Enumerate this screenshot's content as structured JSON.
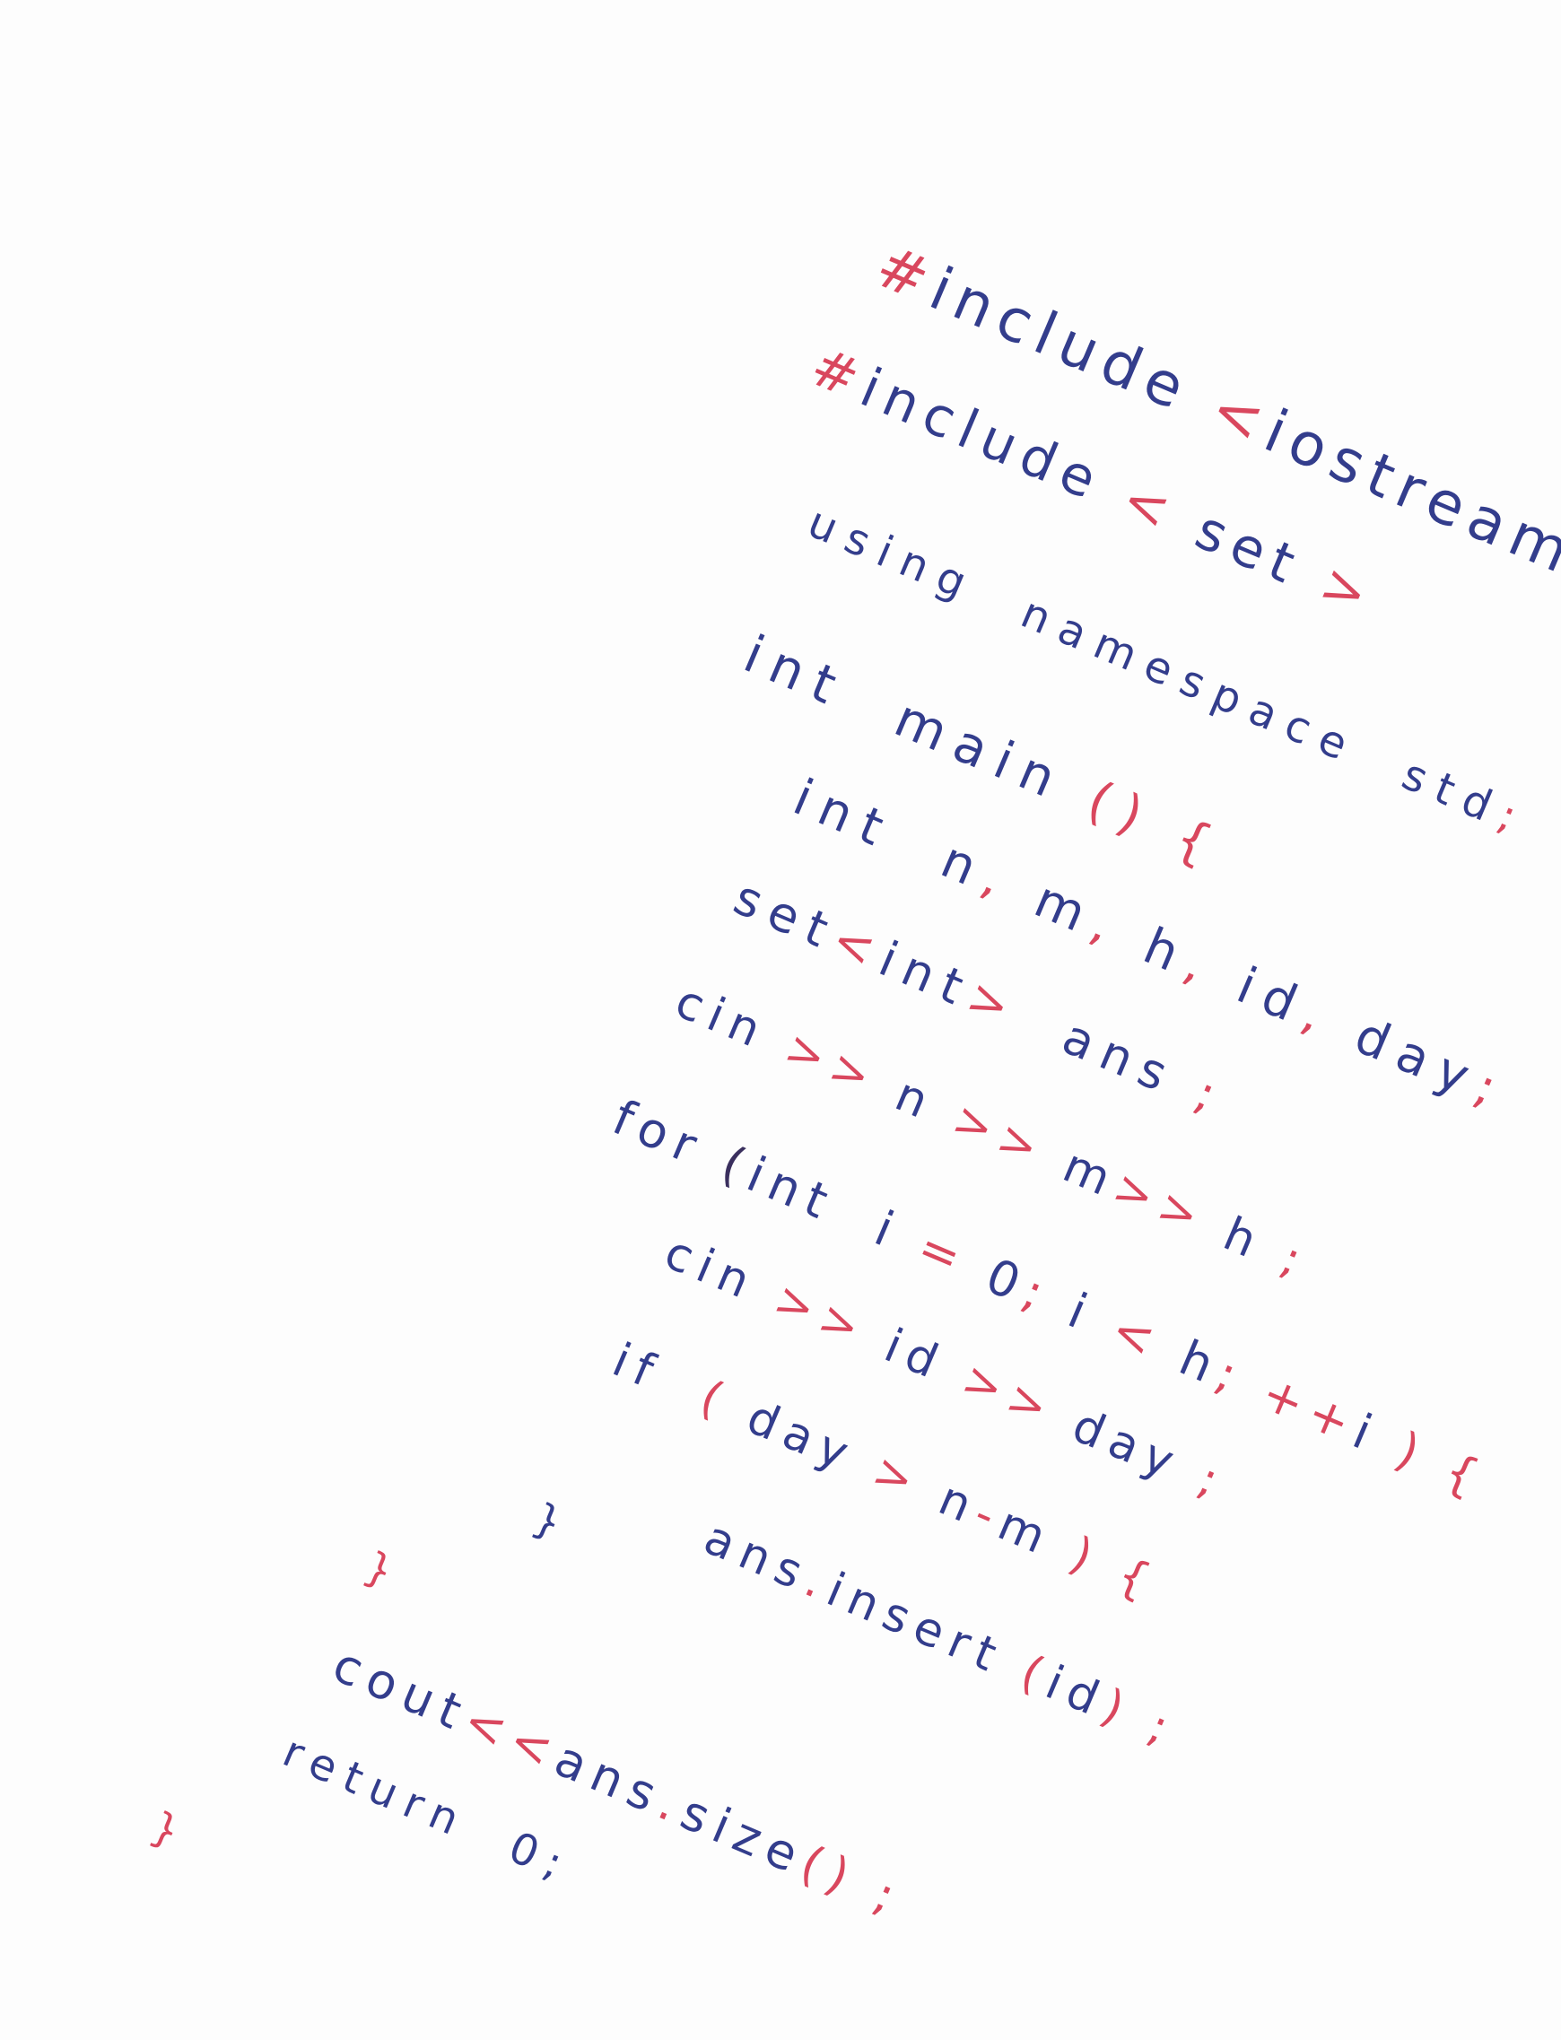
{
  "colors": {
    "ink_red": "#d9475e",
    "ink_blue": "#333d8c",
    "ink_dark": "#3a2f5e",
    "paper": "#fdfdfd"
  },
  "code": {
    "lines": [
      {
        "name": "line-include-iostream",
        "segments": [
          {
            "text": "#",
            "color": "red"
          },
          {
            "text": "include",
            "color": "blue"
          },
          {
            "text": " <",
            "color": "red"
          },
          {
            "text": "iostream",
            "color": "blue"
          },
          {
            "text": ">",
            "color": "red"
          }
        ]
      },
      {
        "name": "line-include-set",
        "segments": [
          {
            "text": "#",
            "color": "red"
          },
          {
            "text": "include",
            "color": "blue"
          },
          {
            "text": " < ",
            "color": "red"
          },
          {
            "text": "set",
            "color": "blue"
          },
          {
            "text": " >",
            "color": "red"
          }
        ]
      },
      {
        "name": "line-using-namespace",
        "segments": [
          {
            "text": "using  namespace  std",
            "color": "blue"
          },
          {
            "text": ";",
            "color": "red"
          }
        ]
      },
      {
        "name": "line-int-main",
        "segments": [
          {
            "text": "int  main ",
            "color": "blue"
          },
          {
            "text": "() {",
            "color": "red"
          }
        ]
      },
      {
        "name": "line-int-declarations",
        "segments": [
          {
            "text": "int  n",
            "color": "blue"
          },
          {
            "text": ", ",
            "color": "red"
          },
          {
            "text": "m",
            "color": "blue"
          },
          {
            "text": ", ",
            "color": "red"
          },
          {
            "text": "h",
            "color": "blue"
          },
          {
            "text": ", ",
            "color": "red"
          },
          {
            "text": "id",
            "color": "blue"
          },
          {
            "text": ", ",
            "color": "red"
          },
          {
            "text": "day",
            "color": "blue"
          },
          {
            "text": ";",
            "color": "red"
          }
        ]
      },
      {
        "name": "line-set-ans",
        "segments": [
          {
            "text": "set",
            "color": "blue"
          },
          {
            "text": "<",
            "color": "red"
          },
          {
            "text": "int",
            "color": "blue"
          },
          {
            "text": ">",
            "color": "red"
          },
          {
            "text": "  ans",
            "color": "blue"
          },
          {
            "text": " ;",
            "color": "red"
          }
        ]
      },
      {
        "name": "line-cin-n-m-h",
        "segments": [
          {
            "text": "cin ",
            "color": "blue"
          },
          {
            "text": ">>",
            "color": "red"
          },
          {
            "text": " n ",
            "color": "blue"
          },
          {
            "text": ">>",
            "color": "red"
          },
          {
            "text": " m",
            "color": "blue"
          },
          {
            "text": ">>",
            "color": "red"
          },
          {
            "text": " h",
            "color": "blue"
          },
          {
            "text": " ;",
            "color": "red"
          }
        ]
      },
      {
        "name": "line-for-loop",
        "segments": [
          {
            "text": "for ",
            "color": "blue"
          },
          {
            "text": "(",
            "color": "dark"
          },
          {
            "text": "int  i ",
            "color": "blue"
          },
          {
            "text": "= ",
            "color": "red"
          },
          {
            "text": "0",
            "color": "blue"
          },
          {
            "text": "; ",
            "color": "red"
          },
          {
            "text": "i ",
            "color": "blue"
          },
          {
            "text": "< ",
            "color": "red"
          },
          {
            "text": "h",
            "color": "blue"
          },
          {
            "text": "; ",
            "color": "red"
          },
          {
            "text": "++",
            "color": "red"
          },
          {
            "text": "i",
            "color": "blue"
          },
          {
            "text": " ) {",
            "color": "red"
          }
        ]
      },
      {
        "name": "line-cin-id-day",
        "segments": [
          {
            "text": "cin ",
            "color": "blue"
          },
          {
            "text": ">>",
            "color": "red"
          },
          {
            "text": " id ",
            "color": "blue"
          },
          {
            "text": ">>",
            "color": "red"
          },
          {
            "text": " day",
            "color": "blue"
          },
          {
            "text": " ;",
            "color": "red"
          }
        ]
      },
      {
        "name": "line-if-condition",
        "segments": [
          {
            "text": "if  ",
            "color": "blue"
          },
          {
            "text": "( ",
            "color": "red"
          },
          {
            "text": "day ",
            "color": "blue"
          },
          {
            "text": "> ",
            "color": "red"
          },
          {
            "text": "n",
            "color": "blue"
          },
          {
            "text": "-",
            "color": "red"
          },
          {
            "text": "m",
            "color": "blue"
          },
          {
            "text": " ) {",
            "color": "red"
          }
        ]
      },
      {
        "name": "line-ans-insert",
        "segments": [
          {
            "text": "ans",
            "color": "blue"
          },
          {
            "text": ".",
            "color": "red"
          },
          {
            "text": "insert ",
            "color": "blue"
          },
          {
            "text": "(",
            "color": "red"
          },
          {
            "text": "id",
            "color": "blue"
          },
          {
            "text": ")",
            "color": "red"
          },
          {
            "text": " ;",
            "color": "red"
          }
        ]
      },
      {
        "name": "line-close-if",
        "segments": [
          {
            "text": "}",
            "color": "blue"
          }
        ]
      },
      {
        "name": "line-close-for",
        "segments": [
          {
            "text": "}",
            "color": "red"
          }
        ]
      },
      {
        "name": "line-cout",
        "segments": [
          {
            "text": "cout",
            "color": "blue"
          },
          {
            "text": "<<",
            "color": "red"
          },
          {
            "text": "ans",
            "color": "blue"
          },
          {
            "text": ".",
            "color": "red"
          },
          {
            "text": "size",
            "color": "blue"
          },
          {
            "text": "()",
            "color": "red"
          },
          {
            "text": " ;",
            "color": "red"
          }
        ]
      },
      {
        "name": "line-return",
        "segments": [
          {
            "text": "return  0",
            "color": "blue"
          },
          {
            "text": ";",
            "color": "blue"
          }
        ]
      },
      {
        "name": "line-close-main",
        "segments": [
          {
            "text": "}",
            "color": "red"
          }
        ]
      }
    ]
  }
}
